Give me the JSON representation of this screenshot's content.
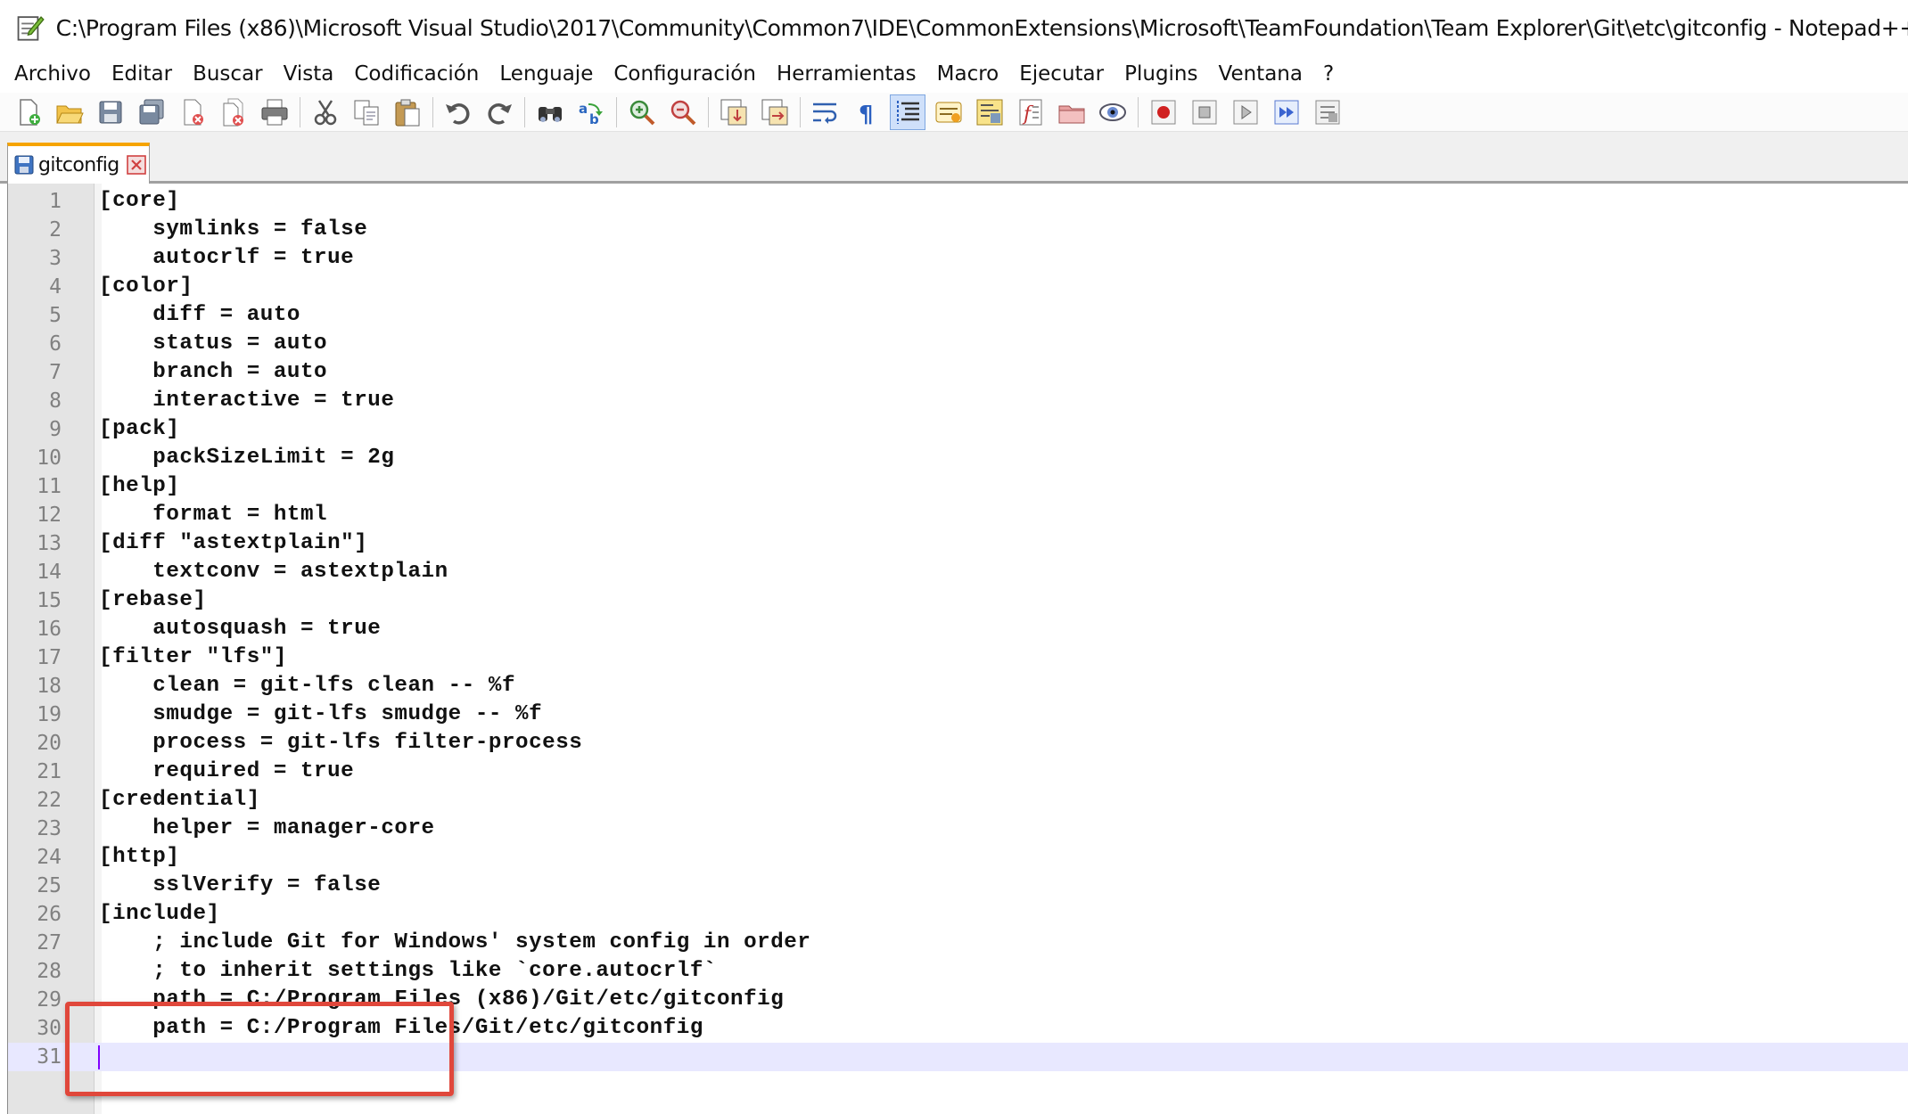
{
  "window": {
    "title": "C:\\Program Files (x86)\\Microsoft Visual Studio\\2017\\Community\\Common7\\IDE\\CommonExtensions\\Microsoft\\TeamFoundation\\Team Explorer\\Git\\etc\\gitconfig - Notepad++ [Administrator]",
    "icon": "notepad-icon"
  },
  "menu": [
    "Archivo",
    "Editar",
    "Buscar",
    "Vista",
    "Codificación",
    "Lenguaje",
    "Configuración",
    "Herramientas",
    "Macro",
    "Ejecutar",
    "Plugins",
    "Ventana",
    "?"
  ],
  "toolbar": {
    "groups": [
      [
        "new-file-icon",
        "open-file-icon",
        "save-icon",
        "save-all-icon",
        "close-icon",
        "close-all-icon",
        "print-icon"
      ],
      [
        "cut-icon",
        "copy-icon",
        "paste-icon"
      ],
      [
        "undo-icon",
        "redo-icon"
      ],
      [
        "find-icon",
        "replace-icon"
      ],
      [
        "zoom-in-icon",
        "zoom-out-icon"
      ],
      [
        "sync-vertical-icon",
        "sync-horizontal-icon"
      ],
      [
        "word-wrap-icon",
        "show-all-chars-icon",
        "indent-guide-icon",
        "user-language-icon",
        "doc-map-icon",
        "function-list-icon",
        "folder-workspace-icon",
        "monitoring-icon"
      ],
      [
        "record-macro-icon",
        "stop-macro-icon",
        "play-macro-icon",
        "run-macro-multiple-icon",
        "save-macro-icon"
      ]
    ],
    "active_button": "indent-guide-icon"
  },
  "tabs": [
    {
      "label": "gitconfig",
      "active": true
    }
  ],
  "editor": {
    "lines": [
      {
        "n": "1",
        "text": "[core]"
      },
      {
        "n": "2",
        "text": "    symlinks = false"
      },
      {
        "n": "3",
        "text": "    autocrlf = true"
      },
      {
        "n": "4",
        "text": "[color]"
      },
      {
        "n": "5",
        "text": "    diff = auto"
      },
      {
        "n": "6",
        "text": "    status = auto"
      },
      {
        "n": "7",
        "text": "    branch = auto"
      },
      {
        "n": "8",
        "text": "    interactive = true"
      },
      {
        "n": "9",
        "text": "[pack]"
      },
      {
        "n": "10",
        "text": "    packSizeLimit = 2g"
      },
      {
        "n": "11",
        "text": "[help]"
      },
      {
        "n": "12",
        "text": "    format = html"
      },
      {
        "n": "13",
        "text": "[diff \"astextplain\"]"
      },
      {
        "n": "14",
        "text": "    textconv = astextplain"
      },
      {
        "n": "15",
        "text": "[rebase]"
      },
      {
        "n": "16",
        "text": "    autosquash = true"
      },
      {
        "n": "17",
        "text": "[filter \"lfs\"]"
      },
      {
        "n": "18",
        "text": "    clean = git-lfs clean -- %f"
      },
      {
        "n": "19",
        "text": "    smudge = git-lfs smudge -- %f"
      },
      {
        "n": "20",
        "text": "    process = git-lfs filter-process"
      },
      {
        "n": "21",
        "text": "    required = true"
      },
      {
        "n": "22",
        "text": "[credential]"
      },
      {
        "n": "23",
        "text": "    helper = manager-core"
      },
      {
        "n": "24",
        "text": "[http]"
      },
      {
        "n": "25",
        "text": "    sslVerify = false"
      },
      {
        "n": "26",
        "text": "[include]"
      },
      {
        "n": "27",
        "text": "    ; include Git for Windows' system config in order"
      },
      {
        "n": "28",
        "text": "    ; to inherit settings like `core.autocrlf`"
      },
      {
        "n": "29",
        "text": "    path = C:/Program Files (x86)/Git/etc/gitconfig"
      },
      {
        "n": "30",
        "text": "    path = C:/Program Files/Git/etc/gitconfig"
      },
      {
        "n": "31",
        "text": ""
      }
    ],
    "current_line": "31",
    "highlight_annotation": {
      "from_line": "24",
      "to_line": "25",
      "color": "#e0473b"
    }
  }
}
